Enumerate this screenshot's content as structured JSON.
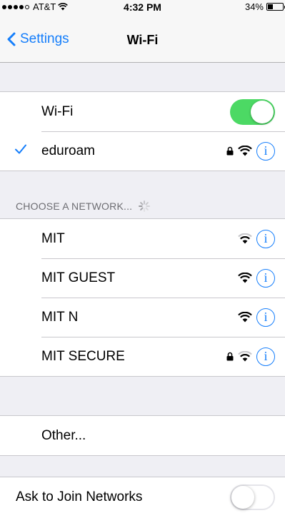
{
  "status_bar": {
    "carrier": "AT&T",
    "time": "4:32 PM",
    "battery_percent": "34%",
    "battery_level": 0.34,
    "signal_bars_filled": 4,
    "signal_bars_total": 5
  },
  "nav": {
    "back_label": "Settings",
    "title": "Wi-Fi"
  },
  "wifi_toggle": {
    "label": "Wi-Fi",
    "on": true
  },
  "connected_network": {
    "name": "eduroam",
    "secured": true
  },
  "networks_section": {
    "header": "CHOOSE A NETWORK..."
  },
  "networks": [
    {
      "name": "MIT",
      "secured": false
    },
    {
      "name": "MIT GUEST",
      "secured": false
    },
    {
      "name": "MIT N",
      "secured": false
    },
    {
      "name": "MIT SECURE",
      "secured": true
    }
  ],
  "other": {
    "label": "Other..."
  },
  "ask_to_join": {
    "label": "Ask to Join Networks",
    "on": false
  },
  "colors": {
    "accent": "#157efb",
    "toggle_on": "#4cd964",
    "background": "#efeff4"
  }
}
